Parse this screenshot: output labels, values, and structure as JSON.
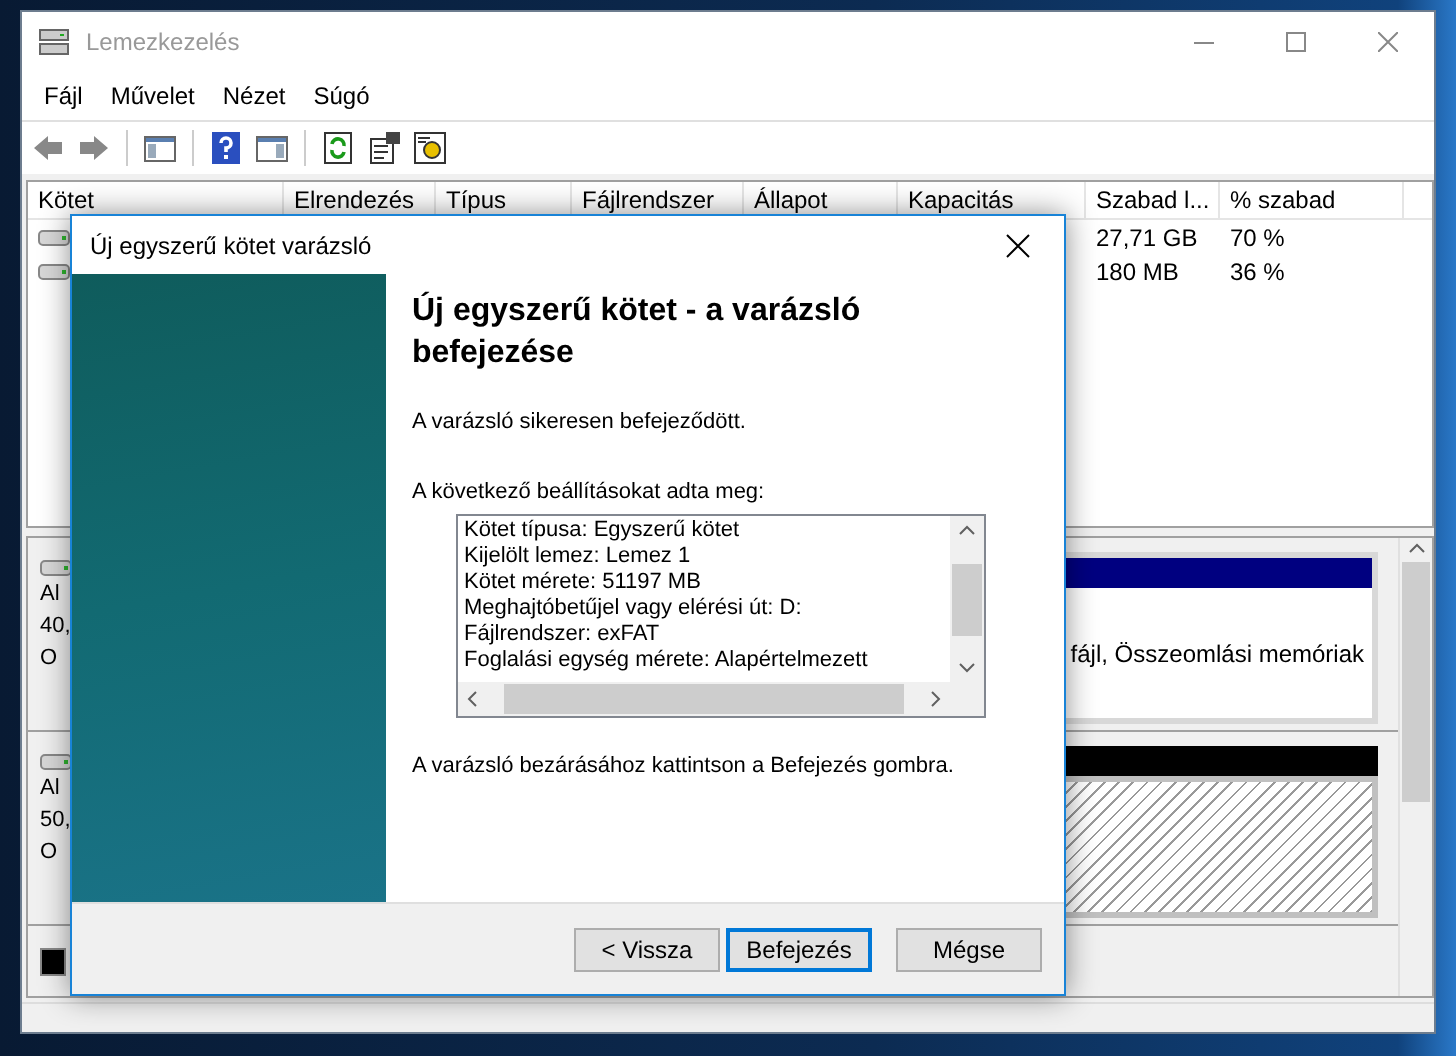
{
  "main_window": {
    "title": "Lemezkezelés",
    "menu": [
      "Fájl",
      "Művelet",
      "Nézet",
      "Súgó"
    ],
    "volume_list": {
      "columns": [
        "Kötet",
        "Elrendezés",
        "Típus",
        "Fájlrendszer",
        "Állapot",
        "Kapacitás",
        "Szabad l...",
        "% szabad"
      ],
      "rows": [
        {
          "free_space": "27,71 GB",
          "percent_free": "70 %"
        },
        {
          "free_space": "180 MB",
          "percent_free": "36 %"
        }
      ]
    },
    "disks": [
      {
        "lines": [
          "Al",
          "40,",
          "O"
        ],
        "partitions": [
          {
            "kind": "primary",
            "text": "fájl, Összeomlási memóriak"
          }
        ]
      },
      {
        "lines": [
          "Al",
          "50,",
          "O"
        ],
        "partitions": [
          {
            "kind": "unallocated"
          }
        ]
      }
    ]
  },
  "dialog": {
    "title": "Új egyszerű kötet varázsló",
    "heading": "Új egyszerű kötet - a varázsló befejezése",
    "message": "A varázsló sikeresen befejeződött.",
    "settings_label": "A következő beállításokat adta meg:",
    "settings": [
      "Kötet típusa: Egyszerű kötet",
      "Kijelölt lemez: Lemez 1",
      "Kötet mérete: 51197 MB",
      "Meghajtóbetűjel vagy elérési út: D:",
      "Fájlrendszer: exFAT",
      "Foglalási egység mérete: Alapértelmezett"
    ],
    "instruction": "A varázsló bezárásához kattintson a Befejezés gombra.",
    "buttons": [
      {
        "label": "< Vissza",
        "default": false
      },
      {
        "label": "Befejezés",
        "default": true
      },
      {
        "label": "Mégse",
        "default": false
      }
    ]
  }
}
